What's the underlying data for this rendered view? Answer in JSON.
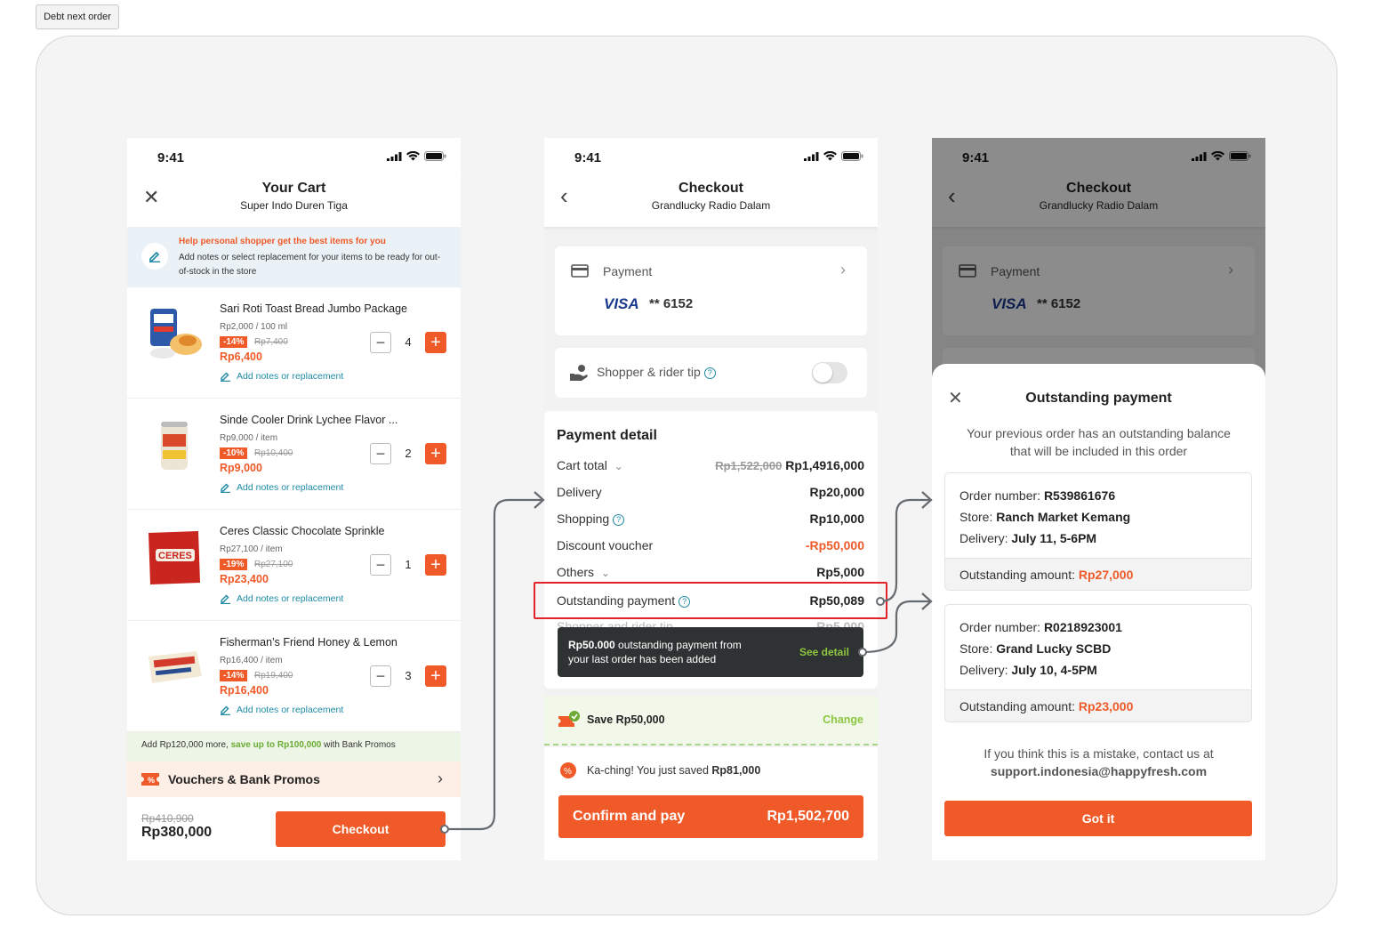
{
  "tab_label": "Debt next order",
  "status_time": "9:41",
  "cart": {
    "title": "Your Cart",
    "subtitle": "Super Indo Duren Tiga",
    "tip_title": "Help personal shopper get the best items for you",
    "tip_text": "Add notes or select replacement for your items to be ready for out-of-stock in the store",
    "note_label": "Add notes or replacement",
    "items": [
      {
        "name": "Sari Roti Toast Bread Jumbo Package",
        "unit": "Rp2,000 / 100 ml",
        "discount": "-14%",
        "old": "Rp7,400",
        "price": "Rp6,400",
        "qty": "4"
      },
      {
        "name": "Sinde Cooler Drink Lychee Flavor ...",
        "unit": "Rp9,000 / item",
        "discount": "-10%",
        "old": "Rp10,400",
        "price": "Rp9,000",
        "qty": "2"
      },
      {
        "name": "Ceres Classic Chocolate Sprinkle",
        "unit": "Rp27,100 / item",
        "discount": "-19%",
        "old": "Rp27,100",
        "price": "Rp23,400",
        "qty": "1"
      },
      {
        "name": "Fisherman’s Friend Honey & Lemon",
        "unit": "Rp16,400 / item",
        "discount": "-14%",
        "old": "Rp19,400",
        "price": "Rp16,400",
        "qty": "3"
      }
    ],
    "promo_prefix": "Add Rp120,000 more,",
    "promo_highlight": "save up to Rp100,000",
    "promo_suffix": "with Bank Promos",
    "vouchers_label": "Vouchers & Bank Promos",
    "total_old": "Rp410,900",
    "total": "Rp380,000",
    "checkout_label": "Checkout"
  },
  "checkout": {
    "title": "Checkout",
    "subtitle": "Grandlucky Radio Dalam",
    "payment_label": "Payment",
    "card_brand": "VISA",
    "card_number": "** 6152",
    "tip_label": "Shopper & rider tip",
    "detail_title": "Payment detail",
    "rows": [
      {
        "label": "Cart total",
        "old": "Rp1,522,000",
        "value": "Rp1,4916,000"
      },
      {
        "label": "Delivery",
        "value": "Rp20,000"
      },
      {
        "label": "Shopping",
        "value": "Rp10,000"
      },
      {
        "label": "Discount voucher",
        "value": "-Rp50,000"
      },
      {
        "label": "Others",
        "value": "Rp5,000"
      },
      {
        "label": "Outstanding payment",
        "value": "Rp50,089"
      }
    ],
    "hidden_row": "Shopper and rider tip",
    "hidden_value": "Rp5,000",
    "toast_bold": "Rp50.000",
    "toast_text1": "outstanding payment from",
    "toast_text2": "your last order has been added",
    "toast_action": "See detail",
    "save_label": "Save Rp50,000",
    "save_action": "Change",
    "saved_prefix": "Ka-ching! You just saved",
    "saved_amount": "Rp81,000",
    "confirm_label": "Confirm and pay",
    "confirm_amount": "Rp1,502,700"
  },
  "sheet": {
    "title": "Outstanding payment",
    "desc1": "Your previous order has an outstanding balance",
    "desc2": "that will be included in this order",
    "order_label": "Order number:",
    "store_label": "Store:",
    "delivery_label": "Delivery:",
    "amount_label": "Outstanding amount:",
    "orders": [
      {
        "number": "R539861676",
        "store": "Ranch Market Kemang",
        "delivery": "July 11, 5-6PM",
        "amount": "Rp27,000"
      },
      {
        "number": "R0218923001",
        "store": "Grand Lucky SCBD",
        "delivery": "July 10, 4-5PM",
        "amount": "Rp23,000"
      }
    ],
    "contact1": "If you think this is a mistake, contact us at",
    "contact2": "support.indonesia@happyfresh.com",
    "button": "Got it"
  },
  "colors": {
    "accent": "#f05a28",
    "teal": "#1e8aa5",
    "green": "#6bab34",
    "highlight": "#e0242a"
  }
}
